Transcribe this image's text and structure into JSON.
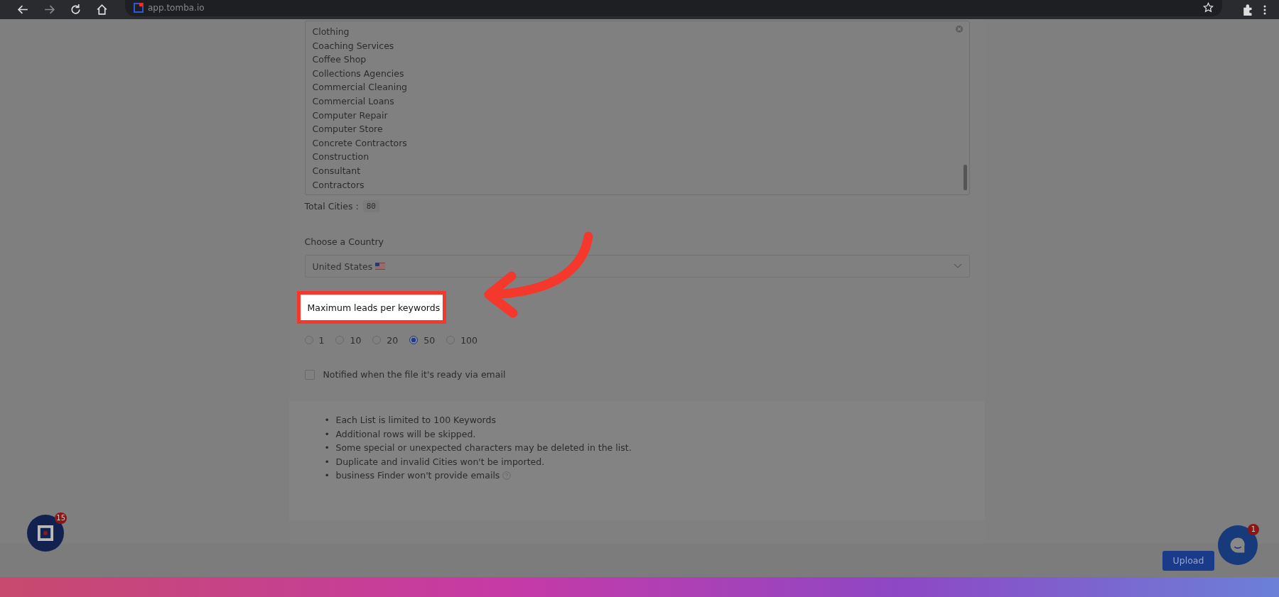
{
  "browser": {
    "url": "app.tomba.io"
  },
  "keywords": {
    "items": [
      "Clothing",
      "Coaching Services",
      "Coffee Shop",
      "Collections Agencies",
      "Commercial Cleaning",
      "Commercial Loans",
      "Computer Repair",
      "Computer Store",
      "Concrete Contractors",
      "Construction",
      "Consultant",
      "Contractors"
    ]
  },
  "total_cities": {
    "label": "Total Cities :",
    "value": "80"
  },
  "country": {
    "label": "Choose a Country",
    "value": "United States"
  },
  "leads": {
    "label": "Maximum leads per keywords",
    "options": [
      {
        "label": "1",
        "selected": false
      },
      {
        "label": "10",
        "selected": false
      },
      {
        "label": "20",
        "selected": false
      },
      {
        "label": "50",
        "selected": true
      },
      {
        "label": "100",
        "selected": false
      }
    ]
  },
  "notify": {
    "label": "Notified when the file it's ready via email",
    "checked": false
  },
  "notes": [
    {
      "bullet": "•",
      "text": "Each List is limited to 100 Keywords",
      "help": false
    },
    {
      "bullet": "•",
      "text": "Additional rows will be skipped.",
      "help": false
    },
    {
      "bullet": "•",
      "text": "Some special or unexpected characters may be deleted in the list.",
      "help": false
    },
    {
      "bullet": "•",
      "text": "Duplicate and invalid Cities won't be imported.",
      "help": false
    },
    {
      "bullet": "•",
      "text": "business Finder won't provide emails",
      "help": true
    }
  ],
  "footer": {
    "button": "Upload"
  },
  "app_badge": {
    "count": "15"
  },
  "chat_badge": {
    "count": "1"
  }
}
